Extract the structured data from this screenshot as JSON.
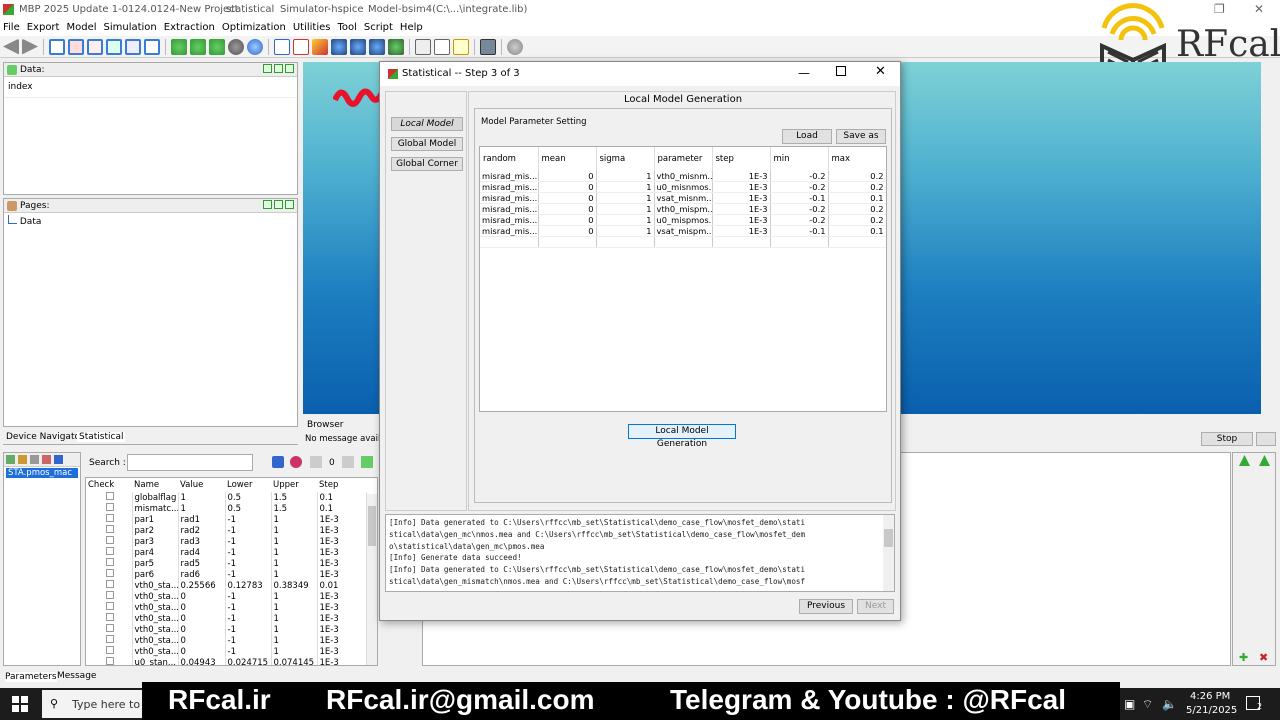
{
  "app": {
    "title_parts": [
      "MBP 2025 Update 1-0124.0124-New Project",
      "statistical",
      "Simulator-hspice",
      "Model-bsim4(C:\\...\\integrate.lib)"
    ],
    "menu": [
      "File",
      "Export",
      "Model",
      "Simulation",
      "Extraction",
      "Optimization",
      "Utilities",
      "Tool",
      "Script",
      "Help"
    ]
  },
  "data_panel": {
    "title": "Data:",
    "item": "index"
  },
  "pages_panel": {
    "title": "Pages:",
    "item": "Data"
  },
  "left_tabs": [
    "Device Navigator",
    "Statistical"
  ],
  "tree": {
    "item": "STA.pmos_mac"
  },
  "search": {
    "label": "Search :",
    "counter": "0"
  },
  "params": {
    "columns": [
      "Check",
      "Name",
      "Value",
      "Lower",
      "Upper",
      "Step"
    ],
    "rows": [
      [
        "globalflag",
        "1",
        "0.5",
        "1.5",
        "0.1"
      ],
      [
        "mismatc...",
        "1",
        "0.5",
        "1.5",
        "0.1"
      ],
      [
        "par1",
        "rad1",
        "-1",
        "1",
        "1E-3"
      ],
      [
        "par2",
        "rad2",
        "-1",
        "1",
        "1E-3"
      ],
      [
        "par3",
        "rad3",
        "-1",
        "1",
        "1E-3"
      ],
      [
        "par4",
        "rad4",
        "-1",
        "1",
        "1E-3"
      ],
      [
        "par5",
        "rad5",
        "-1",
        "1",
        "1E-3"
      ],
      [
        "par6",
        "rad6",
        "-1",
        "1",
        "1E-3"
      ],
      [
        "vth0_sta...",
        "0.25566",
        "0.12783",
        "0.38349",
        "0.01"
      ],
      [
        "vth0_sta...",
        "0",
        "-1",
        "1",
        "1E-3"
      ],
      [
        "vth0_sta...",
        "0",
        "-1",
        "1",
        "1E-3"
      ],
      [
        "vth0_sta...",
        "0",
        "-1",
        "1",
        "1E-3"
      ],
      [
        "vth0_sta...",
        "0",
        "-1",
        "1",
        "1E-3"
      ],
      [
        "vth0_sta...",
        "0",
        "-1",
        "1",
        "1E-3"
      ],
      [
        "vth0_sta...",
        "0",
        "-1",
        "1",
        "1E-3"
      ],
      [
        "u0_stan...",
        "0.04943",
        "0.024715",
        "0.074145",
        "1E-3"
      ]
    ]
  },
  "bottom_tabs": [
    "Parameters",
    "Message"
  ],
  "browser": {
    "tab": "Browser",
    "status": "No message availab"
  },
  "stop_label": "Stop",
  "dialog": {
    "title": "Statistical -- Step 3 of 3",
    "nav": [
      "Local Model",
      "Global Model",
      "Global Corner"
    ],
    "section_title": "Local Model Generation",
    "group_title": "Model Parameter Setting",
    "load_label": "Load",
    "saveas_label": "Save as",
    "columns": [
      "random",
      "mean",
      "sigma",
      "parameter",
      "step",
      "min",
      "max"
    ],
    "rows": [
      [
        "misrad_mis...",
        "0",
        "1",
        "vth0_misnm...",
        "1E-3",
        "-0.2",
        "0.2"
      ],
      [
        "misrad_mis...",
        "0",
        "1",
        "u0_misnmos...",
        "1E-3",
        "-0.2",
        "0.2"
      ],
      [
        "misrad_mis...",
        "0",
        "1",
        "vsat_misnm...",
        "1E-3",
        "-0.1",
        "0.1"
      ],
      [
        "misrad_mis...",
        "0",
        "1",
        "vth0_mispm...",
        "1E-3",
        "-0.2",
        "0.2"
      ],
      [
        "misrad_mis...",
        "0",
        "1",
        "u0_mispmos...",
        "1E-3",
        "-0.2",
        "0.2"
      ],
      [
        "misrad_mis...",
        "0",
        "1",
        "vsat_mispm...",
        "1E-3",
        "-0.1",
        "0.1"
      ]
    ],
    "generate_label": "Local Model Generation",
    "log_lines": [
      "[Info] Data generated to C:\\Users\\rffcc\\mb_set\\Statistical\\demo_case_flow\\mosfet_demo\\stati",
      "stical\\data\\gen_mc\\nmos.mea and C:\\Users\\rffcc\\mb_set\\Statistical\\demo_case_flow\\mosfet_dem",
      "o\\statistical\\data\\gen_mc\\pmos.mea",
      "[Info] Generate data succeed!",
      "[Info] Data generated to C:\\Users\\rffcc\\mb_set\\Statistical\\demo_case_flow\\mosfet_demo\\stati",
      "stical\\data\\gen_mismatch\\nmos.mea and C:\\Users\\rffcc\\mb_set\\Statistical\\demo_case_flow\\mosf"
    ],
    "previous_label": "Previous",
    "next_label": "Next"
  },
  "logo": {
    "text": "RFcal"
  },
  "banner": {
    "site": "RFcal.ir",
    "email": "RFcal.ir@gmail.com",
    "social": "Telegram & Youtube : @RFcal"
  },
  "taskbar": {
    "search_placeholder": "Type here to search",
    "time": "4:26 PM",
    "date": "5/21/2025",
    "notif_count": "2"
  }
}
